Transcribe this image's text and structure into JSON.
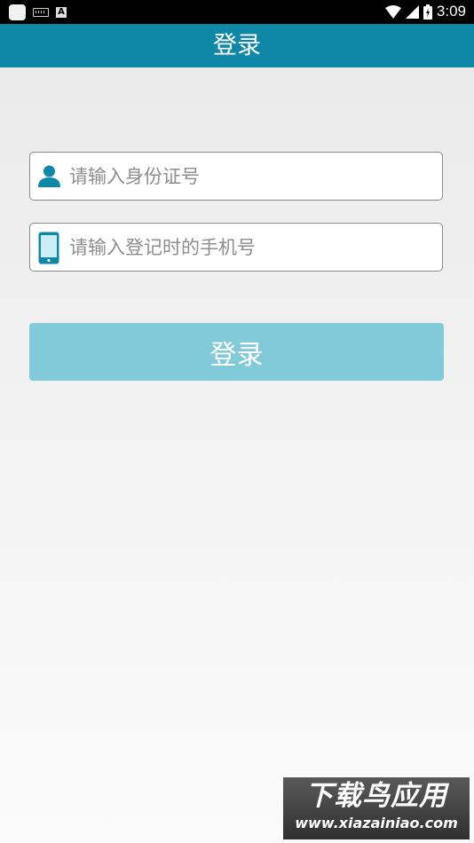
{
  "status_bar": {
    "time": "3:09",
    "icons": [
      "notification-square-icon",
      "keyboard-icon",
      "a-badge-icon",
      "wifi-icon",
      "signal-icon",
      "battery-icon"
    ]
  },
  "app_bar": {
    "title": "登录",
    "color": "#0e88a6"
  },
  "form": {
    "id_field": {
      "placeholder": "请输入身份证号",
      "value": "",
      "icon": "user-icon"
    },
    "phone_field": {
      "placeholder": "请输入登记时的手机号",
      "value": "",
      "icon": "phone-icon"
    },
    "login_button": {
      "label": "登录",
      "color": "#80cad9"
    }
  },
  "watermark": {
    "line1": "下载鸟应用",
    "line2": "www.xiazainiao.com"
  }
}
